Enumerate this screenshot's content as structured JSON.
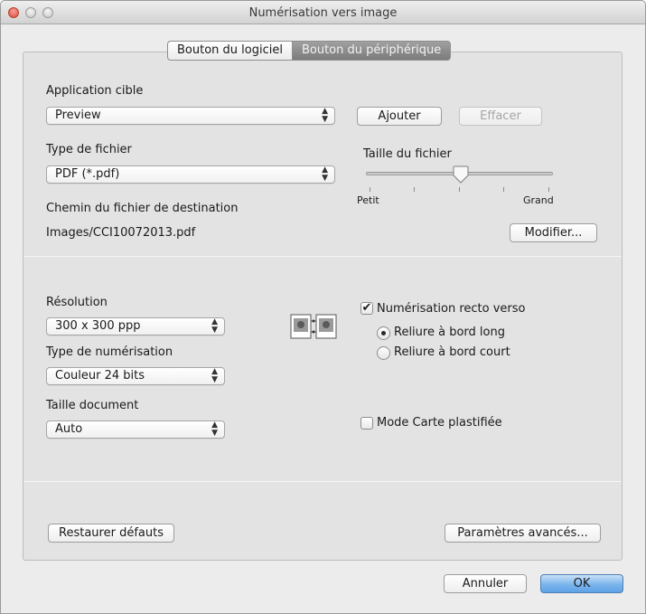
{
  "window": {
    "title": "Numérisation vers image"
  },
  "tabs": [
    {
      "label": "Bouton du logiciel",
      "selected": false
    },
    {
      "label": "Bouton du périphérique",
      "selected": true
    }
  ],
  "target_app": {
    "label": "Application cible",
    "value": "Preview",
    "add_button": "Ajouter",
    "delete_button": "Effacer"
  },
  "file_type": {
    "label": "Type de fichier",
    "value": "PDF (*.pdf)"
  },
  "file_size": {
    "label": "Taille du fichier",
    "min_label": "Petit",
    "max_label": "Grand",
    "level": 0.5
  },
  "destination": {
    "label": "Chemin du fichier de destination",
    "path": "Images/CCI10072013.pdf",
    "modify_button": "Modifier..."
  },
  "resolution": {
    "label": "Résolution",
    "value": "300 x 300 ppp"
  },
  "scan_type": {
    "label": "Type de numérisation",
    "value": "Couleur 24 bits"
  },
  "doc_size": {
    "label": "Taille document",
    "value": "Auto"
  },
  "duplex": {
    "label": "Numérisation recto verso",
    "checked": true,
    "options": [
      {
        "label": "Reliure à bord long",
        "selected": true
      },
      {
        "label": "Reliure à bord court",
        "selected": false
      }
    ]
  },
  "card_mode": {
    "label": "Mode Carte plastifiée",
    "checked": false
  },
  "buttons": {
    "restore": "Restaurer défauts",
    "advanced": "Paramètres avancés...",
    "cancel": "Annuler",
    "ok": "OK"
  },
  "icons": {
    "checkmark": "✔",
    "popup_arrows": "⌃⌄"
  }
}
